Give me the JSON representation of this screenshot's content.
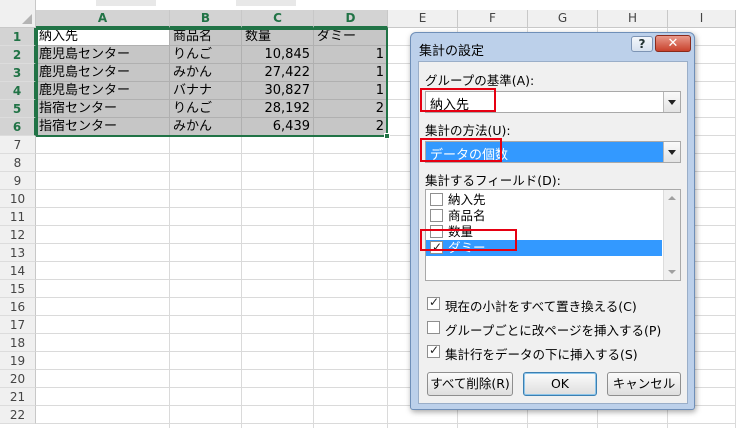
{
  "sheet": {
    "columns": [
      "A",
      "B",
      "C",
      "D",
      "E",
      "F",
      "G",
      "H",
      "I"
    ],
    "rows": [
      "1",
      "2",
      "3",
      "4",
      "5",
      "6",
      "7",
      "8",
      "9",
      "10",
      "11",
      "12",
      "13",
      "14",
      "15",
      "16",
      "17",
      "18",
      "19",
      "20",
      "21",
      "22"
    ],
    "table": [
      [
        "納入先",
        "商品名",
        "数量",
        "ダミー"
      ],
      [
        "鹿児島センター",
        "りんご",
        "10,845",
        "1"
      ],
      [
        "鹿児島センター",
        "みかん",
        "27,422",
        "1"
      ],
      [
        "鹿児島センター",
        "バナナ",
        "30,827",
        "1"
      ],
      [
        "指宿センター",
        "りんご",
        "28,192",
        "2"
      ],
      [
        "指宿センター",
        "みかん",
        "6,439",
        "2"
      ]
    ]
  },
  "dialog": {
    "title": "集計の設定",
    "help": "?",
    "close": "✕",
    "group_label": "グループの基準(A):",
    "group_value": "納入先",
    "func_label": "集計の方法(U):",
    "func_value": "データの個数",
    "fields_label": "集計するフィールド(D):",
    "fields": [
      {
        "label": "納入先",
        "checked": false
      },
      {
        "label": "商品名",
        "checked": false
      },
      {
        "label": "数量",
        "checked": false
      },
      {
        "label": "ダミー",
        "checked": true
      }
    ],
    "options": [
      {
        "label": "現在の小計をすべて置き換える(C)",
        "checked": true
      },
      {
        "label": "グループごとに改ページを挿入する(P)",
        "checked": false
      },
      {
        "label": "集計行をデータの下に挿入する(S)",
        "checked": true
      }
    ],
    "btn_remove": "すべて削除(R)",
    "btn_ok": "OK",
    "btn_cancel": "キャンセル"
  },
  "colors": {
    "selection": "#217346",
    "highlight": "#3399ff",
    "annotation": "#e60012"
  }
}
